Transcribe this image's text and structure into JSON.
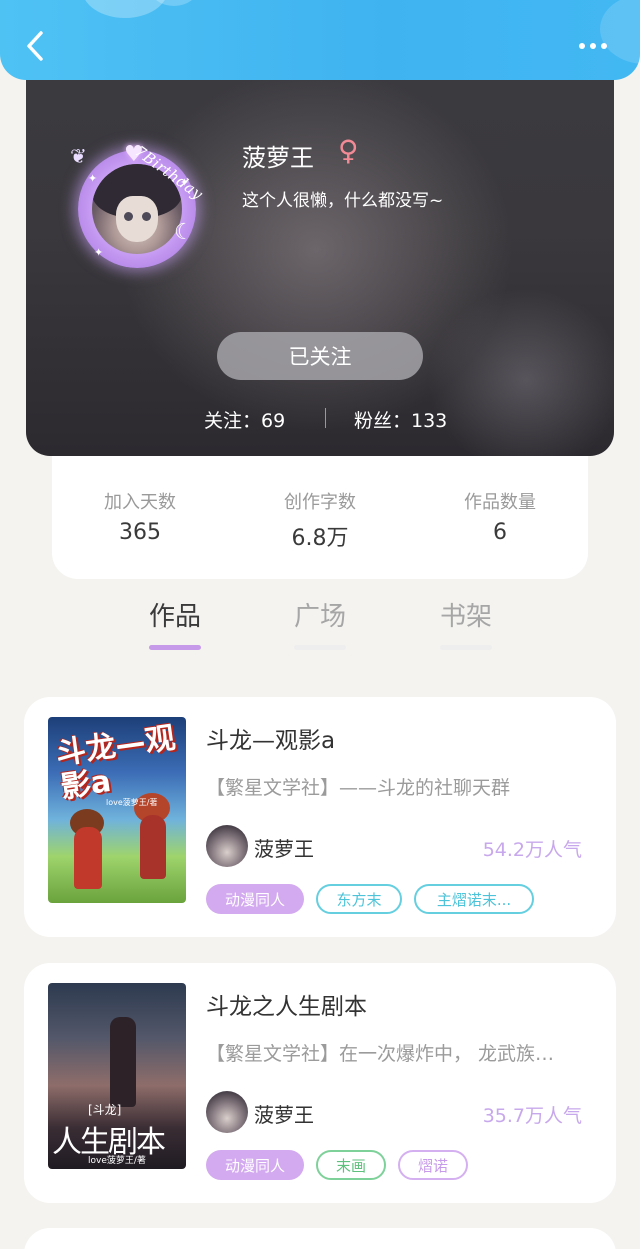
{
  "header": {
    "back_icon": "chevron-left-icon",
    "more_icon": "more-dots-icon",
    "accent": "#42b6f2"
  },
  "profile": {
    "username": "菠萝王",
    "gender_symbol": "♀",
    "bio": "这个人很懒，什么都没写~",
    "avatar_badge_text": "7Birthday",
    "follow_button_label": "已关注",
    "following": "关注：69",
    "fans": "粉丝：133"
  },
  "stats": [
    {
      "label": "加入天数",
      "value": "365"
    },
    {
      "label": "创作字数",
      "value": "6.8万"
    },
    {
      "label": "作品数量",
      "value": "6"
    }
  ],
  "tabs": [
    {
      "label": "作品",
      "active": true
    },
    {
      "label": "广场",
      "active": false
    },
    {
      "label": "书架",
      "active": false
    }
  ],
  "books": [
    {
      "title": "斗龙—观影a",
      "description": "【繁星文学社】——斗龙的社聊天群",
      "author": "菠萝王",
      "popularity": "54.2万人气",
      "cover_text": "斗龙—观影a",
      "cover_subtext": "love菠萝王/著",
      "tags": [
        "动漫同人",
        "东方末",
        "主熠诺末..."
      ]
    },
    {
      "title": "斗龙之人生剧本",
      "description": "【繁星文学社】在一次爆炸中， 龙武族…",
      "author": "菠萝王",
      "popularity": "35.7万人气",
      "cover_text": "人生剧本",
      "cover_bracket": "[斗龙]",
      "cover_subtext": "love菠萝王/著",
      "tags": [
        "动漫同人",
        "末画",
        "熠诺"
      ]
    }
  ],
  "colors": {
    "tab_active_underline": "#c69ae9",
    "popularity_text": "#c8a8ec",
    "tag_solid": "#d3a9ef"
  }
}
